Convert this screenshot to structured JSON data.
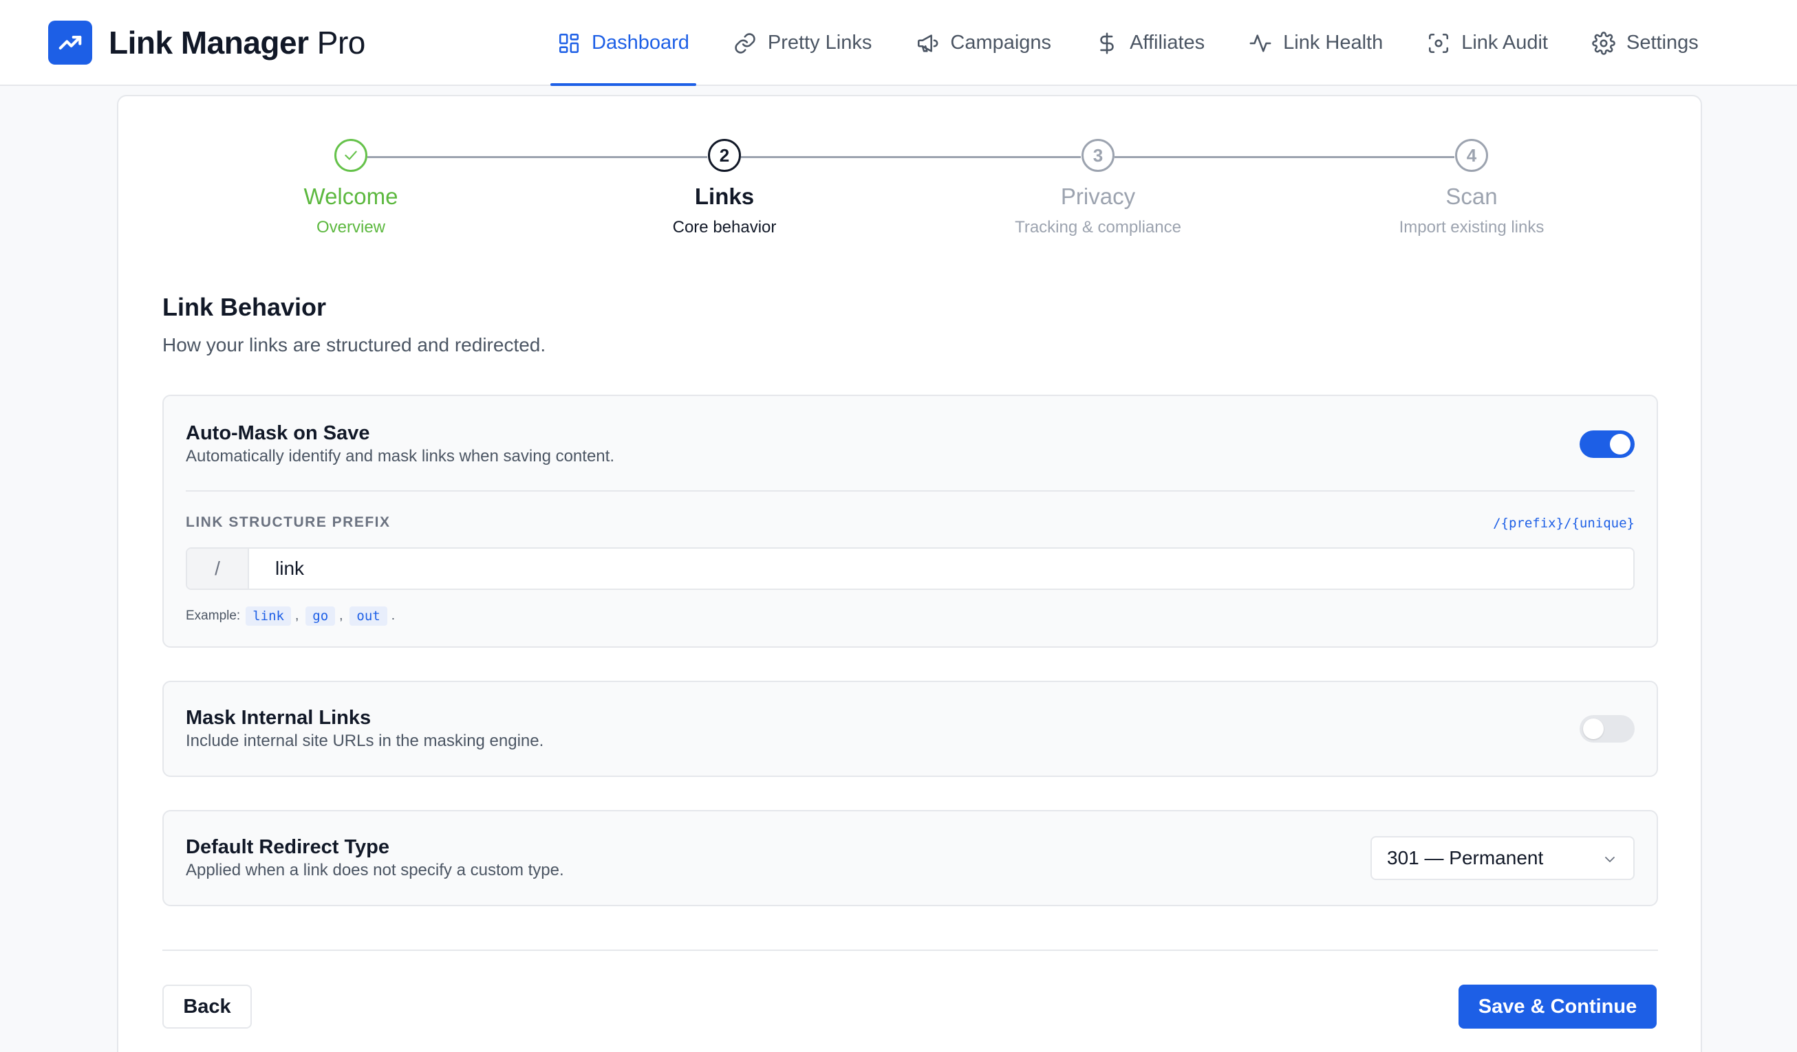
{
  "brand": {
    "name_bold": "Link Manager",
    "name_light": "Pro",
    "logo_icon": "trending-up-icon"
  },
  "nav": [
    {
      "label": "Dashboard",
      "icon": "grid-icon",
      "active": true
    },
    {
      "label": "Pretty Links",
      "icon": "link-icon",
      "active": false
    },
    {
      "label": "Campaigns",
      "icon": "megaphone-icon",
      "active": false
    },
    {
      "label": "Affiliates",
      "icon": "dollar-icon",
      "active": false
    },
    {
      "label": "Link Health",
      "icon": "activity-icon",
      "active": false
    },
    {
      "label": "Link Audit",
      "icon": "scan-icon",
      "active": false
    },
    {
      "label": "Settings",
      "icon": "gear-icon",
      "active": false
    }
  ],
  "stepper": [
    {
      "number": "1",
      "title": "Welcome",
      "subtitle": "Overview",
      "state": "done"
    },
    {
      "number": "2",
      "title": "Links",
      "subtitle": "Core behavior",
      "state": "current"
    },
    {
      "number": "3",
      "title": "Privacy",
      "subtitle": "Tracking & compliance",
      "state": "upcoming"
    },
    {
      "number": "4",
      "title": "Scan",
      "subtitle": "Import existing links",
      "state": "upcoming"
    }
  ],
  "section": {
    "title": "Link Behavior",
    "description": "How your links are structured and redirected."
  },
  "auto_mask": {
    "title": "Auto-Mask on Save",
    "description": "Automatically identify and mask links when saving content.",
    "enabled": true,
    "field_label": "LINK STRUCTURE PREFIX",
    "pattern": "/{prefix}/{unique}",
    "prefix_symbol": "/",
    "value": "link",
    "example_label": "Example:",
    "examples": [
      "link",
      "go",
      "out"
    ],
    "example_end": "."
  },
  "mask_internal": {
    "title": "Mask Internal Links",
    "description": "Include internal site URLs in the masking engine.",
    "enabled": false
  },
  "redirect": {
    "title": "Default Redirect Type",
    "description": "Applied when a link does not specify a custom type.",
    "selected": "301 — Permanent"
  },
  "actions": {
    "back": "Back",
    "primary": "Save & Continue"
  },
  "colors": {
    "accent": "#1d5fe6",
    "success": "#5cb83f",
    "muted": "#9ca3af"
  }
}
